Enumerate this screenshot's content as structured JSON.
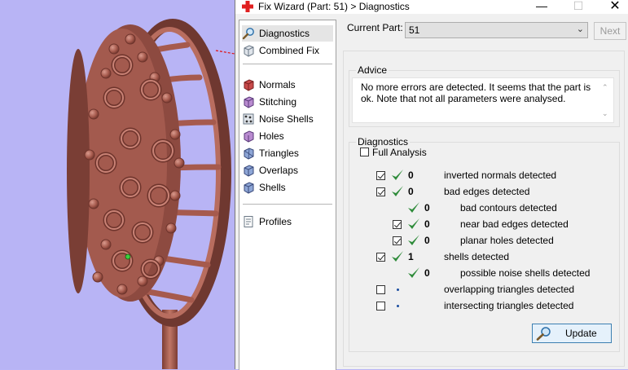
{
  "window": {
    "title": "Fix Wizard (Part: 51) > Diagnostics",
    "minimize": "—",
    "maximize": "☐",
    "close": "✕"
  },
  "nav": {
    "items": [
      {
        "label": "Diagnostics",
        "icon": "magnifier-icon",
        "selected": true
      },
      {
        "label": "Combined Fix",
        "icon": "cube-icon"
      },
      {
        "label": "Normals",
        "icon": "normals-icon"
      },
      {
        "label": "Stitching",
        "icon": "stitching-icon"
      },
      {
        "label": "Noise Shells",
        "icon": "noise-shells-icon"
      },
      {
        "label": "Holes",
        "icon": "holes-icon"
      },
      {
        "label": "Triangles",
        "icon": "triangles-icon"
      },
      {
        "label": "Overlaps",
        "icon": "overlaps-icon"
      },
      {
        "label": "Shells",
        "icon": "shells-icon"
      },
      {
        "label": "Profiles",
        "icon": "profiles-icon"
      }
    ]
  },
  "current_part": {
    "label": "Current Part:",
    "value": "51",
    "next_label": "Next"
  },
  "advice": {
    "title": "Advice",
    "text": "No more errors are detected. It seems that the part is ok. Note that not all parameters were analysed."
  },
  "diagnostics": {
    "title": "Diagnostics",
    "full_analysis_label": "Full Analysis",
    "full_analysis_checked": false,
    "rows": [
      {
        "checked": true,
        "status": "ok",
        "count": "0",
        "label": "inverted normals detected",
        "indent": 0
      },
      {
        "checked": true,
        "status": "ok",
        "count": "0",
        "label": "bad edges detected",
        "indent": 0
      },
      {
        "checked": null,
        "status": "ok",
        "count": "0",
        "label": "bad contours detected",
        "indent": 1
      },
      {
        "checked": true,
        "status": "ok",
        "count": "0",
        "label": "near bad edges detected",
        "indent": 1
      },
      {
        "checked": true,
        "status": "ok",
        "count": "0",
        "label": "planar holes detected",
        "indent": 1
      },
      {
        "checked": true,
        "status": "ok",
        "count": "1",
        "label": "shells detected",
        "indent": 0
      },
      {
        "checked": null,
        "status": "ok",
        "count": "0",
        "label": "possible noise shells detected",
        "indent": 1
      },
      {
        "checked": false,
        "status": "none",
        "count": "",
        "label": "overlapping triangles detected",
        "indent": 0
      },
      {
        "checked": false,
        "status": "none",
        "count": "",
        "label": "intersecting triangles detected",
        "indent": 0
      }
    ],
    "update_label": "Update"
  },
  "colors": {
    "viewport_bg": "#b8b4f5",
    "model": "#b0665a",
    "tick_green": "#2e8b3a",
    "dialog_bg": "#f0f0f0"
  }
}
